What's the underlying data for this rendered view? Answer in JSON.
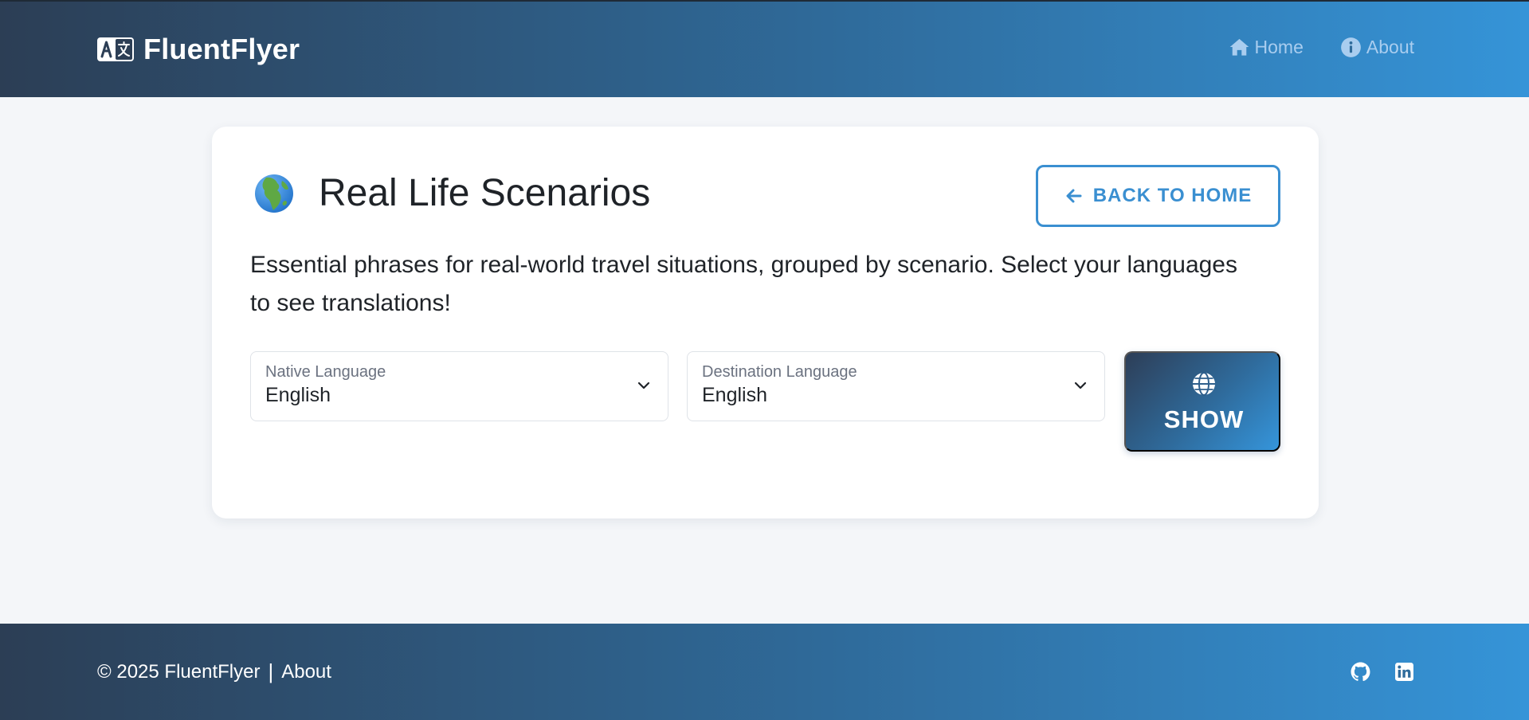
{
  "header": {
    "brand_name": "FluentFlyer",
    "brand_icon": "translate-icon",
    "nav": [
      {
        "label": "Home",
        "icon": "home-icon"
      },
      {
        "label": "About",
        "icon": "info-circle-icon"
      }
    ]
  },
  "card": {
    "title": "Real Life Scenarios",
    "title_icon": "globe-africa-emoji",
    "back_button_label": "BACK TO HOME",
    "description": "Essential phrases for real-world travel situations, grouped by scenario. Select your languages to see translations!",
    "native_select": {
      "label": "Native Language",
      "value": "English"
    },
    "destination_select": {
      "label": "Destination Language",
      "value": "English"
    },
    "show_button_label": "SHOW"
  },
  "footer": {
    "copyright": "© 2025 FluentFlyer",
    "separator": "|",
    "about_link": "About",
    "socials": [
      "github-icon",
      "linkedin-icon"
    ]
  },
  "colors": {
    "accent": "#3a8fd1",
    "header_gradient_start": "#2c3e55",
    "header_gradient_end": "#3594d8",
    "background": "#f4f6f9"
  }
}
